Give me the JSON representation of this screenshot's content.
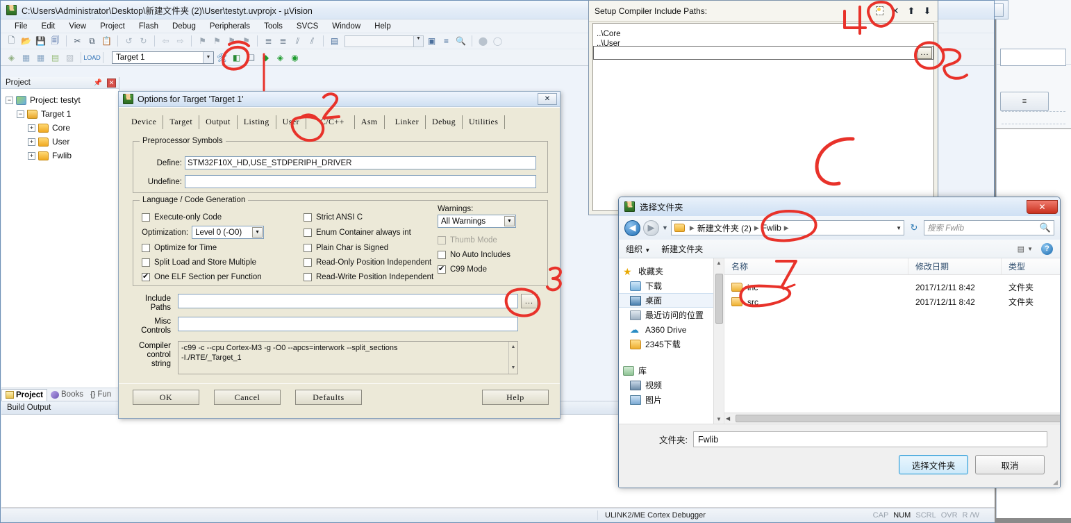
{
  "app": {
    "title": "C:\\Users\\Administrator\\Desktop\\新建文件夹 (2)\\User\\testyt.uvprojx - µVision",
    "menu": [
      "File",
      "Edit",
      "View",
      "Project",
      "Flash",
      "Debug",
      "Peripherals",
      "Tools",
      "SVCS",
      "Window",
      "Help"
    ],
    "target_combo": "Target 1"
  },
  "project_panel": {
    "title": "Project",
    "pin_icon": "pin-icon",
    "close_icon": "close-icon",
    "tree": [
      {
        "label": "Project: testyt",
        "icon": "project-icon",
        "expander": "-",
        "indent": 0
      },
      {
        "label": "Target 1",
        "icon": "target-icon",
        "expander": "-",
        "indent": 1
      },
      {
        "label": "Core",
        "icon": "folder-icon",
        "expander": "+",
        "indent": 2
      },
      {
        "label": "User",
        "icon": "folder-icon",
        "expander": "+",
        "indent": 2
      },
      {
        "label": "Fwlib",
        "icon": "folder-icon",
        "expander": "+",
        "indent": 2
      }
    ],
    "tabs": [
      {
        "label": "Project",
        "icon": "project-tab-icon",
        "active": true
      },
      {
        "label": "Books",
        "icon": "books-icon",
        "active": false
      },
      {
        "label": "Fun",
        "icon": "functions-icon",
        "active": false
      }
    ]
  },
  "build_output": {
    "title": "Build Output"
  },
  "status_bar": {
    "debugger": "ULINK2/ME Cortex Debugger",
    "flags": [
      {
        "label": "CAP",
        "on": false
      },
      {
        "label": "NUM",
        "on": true
      },
      {
        "label": "SCRL",
        "on": false
      },
      {
        "label": "OVR",
        "on": false
      },
      {
        "label": "R /W",
        "on": false
      }
    ]
  },
  "options_dialog": {
    "title": "Options for Target 'Target 1'",
    "close_icon": "close-icon",
    "tabs": [
      {
        "label": "Device",
        "active": false
      },
      {
        "label": "Target",
        "active": false
      },
      {
        "label": "Output",
        "active": false
      },
      {
        "label": "Listing",
        "active": false
      },
      {
        "label": "User",
        "active": false
      },
      {
        "label": "C/C++",
        "active": true
      },
      {
        "label": "Asm",
        "active": false
      },
      {
        "label": "Linker",
        "active": false
      },
      {
        "label": "Debug",
        "active": false
      },
      {
        "label": "Utilities",
        "active": false
      }
    ],
    "preprocessor": {
      "group_label": "Preprocessor Symbols",
      "define_label": "Define:",
      "define_value": "STM32F10X_HD,USE_STDPERIPH_DRIVER",
      "undefine_label": "Undefine:",
      "undefine_value": ""
    },
    "language": {
      "group_label": "Language / Code Generation",
      "col1": [
        {
          "label": "Execute-only Code",
          "checked": false,
          "disabled": false
        },
        {
          "label": "Optimize for Time",
          "checked": false,
          "disabled": false
        },
        {
          "label": "Split Load and Store Multiple",
          "checked": false,
          "disabled": false
        },
        {
          "label": "One ELF Section per Function",
          "checked": true,
          "disabled": false
        }
      ],
      "optimization_label": "Optimization:",
      "optimization_value": "Level 0 (-O0)",
      "col2": [
        {
          "label": "Strict ANSI C",
          "checked": false,
          "disabled": false
        },
        {
          "label": "Enum Container always int",
          "checked": false,
          "disabled": false
        },
        {
          "label": "Plain Char is Signed",
          "checked": false,
          "disabled": false
        },
        {
          "label": "Read-Only Position Independent",
          "checked": false,
          "disabled": false
        },
        {
          "label": "Read-Write Position Independent",
          "checked": false,
          "disabled": false
        }
      ],
      "warnings_label": "Warnings:",
      "warnings_value": "All Warnings",
      "col3": [
        {
          "label": "Thumb Mode",
          "checked": false,
          "disabled": true
        },
        {
          "label": "No Auto Includes",
          "checked": false,
          "disabled": false
        },
        {
          "label": "C99 Mode",
          "checked": true,
          "disabled": false
        }
      ]
    },
    "include_paths_label": "Include\nPaths",
    "include_paths_label_1": "Include",
    "include_paths_label_2": "Paths",
    "include_paths_value": "",
    "include_paths_browse": "...",
    "misc_label_1": "Misc",
    "misc_label_2": "Controls",
    "misc_value": "",
    "compiler_label_1": "Compiler",
    "compiler_label_2": "control",
    "compiler_label_3": "string",
    "compiler_value": "-c99 -c --cpu Cortex-M3 -g -O0 --apcs=interwork --split_sections\n-I./RTE/_Target_1",
    "compiler_line1": "-c99 -c --cpu Cortex-M3 -g -O0 --apcs=interwork --split_sections",
    "compiler_line2": "-I./RTE/_Target_1",
    "buttons": [
      {
        "label": "OK"
      },
      {
        "label": "Cancel"
      },
      {
        "label": "Defaults"
      },
      {
        "label": "Help"
      }
    ]
  },
  "include_paths_dialog": {
    "title": "Setup Compiler Include Paths:",
    "toolbar": [
      {
        "icon": "new-item-icon",
        "name": "new-path-button"
      },
      {
        "icon": "delete-icon",
        "name": "delete-path-button"
      },
      {
        "icon": "move-up-icon",
        "name": "move-up-button"
      },
      {
        "icon": "move-down-icon",
        "name": "move-down-button"
      }
    ],
    "items": [
      "..\\Core",
      "..\\User"
    ],
    "edit_value": "",
    "browse_button": "..."
  },
  "folder_dialog": {
    "title": "选择文件夹",
    "close_icon": "close-icon",
    "nav": {
      "back_icon": "back-arrow-icon",
      "forward_icon": "forward-arrow-icon",
      "dropdown_icon": "chevron-down-icon",
      "breadcrumb": [
        "新建文件夹 (2)",
        "Fwlib"
      ],
      "refresh_icon": "refresh-icon",
      "search_placeholder": "搜索 Fwlib",
      "search_icon": "search-icon"
    },
    "toolbar": {
      "organize": "组织",
      "new_folder": "新建文件夹",
      "view_icon": "view-mode-icon",
      "help_icon": "help-icon"
    },
    "sidebar": [
      {
        "label": "收藏夹",
        "icon": "favorites-star-icon",
        "indent": 0,
        "selected": false
      },
      {
        "label": "下载",
        "icon": "downloads-icon",
        "indent": 1,
        "selected": false
      },
      {
        "label": "桌面",
        "icon": "desktop-icon",
        "indent": 1,
        "selected": true
      },
      {
        "label": "最近访问的位置",
        "icon": "recent-places-icon",
        "indent": 1,
        "selected": false
      },
      {
        "label": "A360 Drive",
        "icon": "a360-drive-icon",
        "indent": 1,
        "selected": false
      },
      {
        "label": "2345下载",
        "icon": "folder-icon",
        "indent": 1,
        "selected": false
      },
      {
        "label": "",
        "icon": "",
        "indent": 0,
        "selected": false
      },
      {
        "label": "库",
        "icon": "library-icon",
        "indent": 0,
        "selected": false
      },
      {
        "label": "视频",
        "icon": "videos-icon",
        "indent": 1,
        "selected": false
      },
      {
        "label": "图片",
        "icon": "pictures-icon",
        "indent": 1,
        "selected": false
      }
    ],
    "columns": [
      "名称",
      "修改日期",
      "类型"
    ],
    "rows": [
      {
        "name": "inc",
        "modified": "2017/12/11 8:42",
        "type": "文件夹"
      },
      {
        "name": "src",
        "modified": "2017/12/11 8:42",
        "type": "文件夹"
      }
    ],
    "folder_label": "文件夹:",
    "folder_value": "Fwlib",
    "select_button": "选择文件夹",
    "cancel_button": "取消"
  },
  "annotations": [
    {
      "id": "1",
      "text": "1",
      "target": "configure-target-options-toolbar-button"
    },
    {
      "id": "2",
      "text": "2",
      "target": "cc-tab"
    },
    {
      "id": "3",
      "text": "3",
      "target": "include-paths-browse-button"
    },
    {
      "id": "4",
      "text": "4",
      "target": "new-path-button"
    },
    {
      "id": "5",
      "text": "5",
      "target": "path-browse-button"
    },
    {
      "id": "6",
      "text": "6",
      "target": "path-list-area"
    },
    {
      "id": "7",
      "text": "7",
      "target": "folder-inc-row"
    }
  ],
  "colors": {
    "annotation": "#e8322a",
    "accent": "#2c9ad6",
    "titlebar": "#dbe7f5"
  }
}
